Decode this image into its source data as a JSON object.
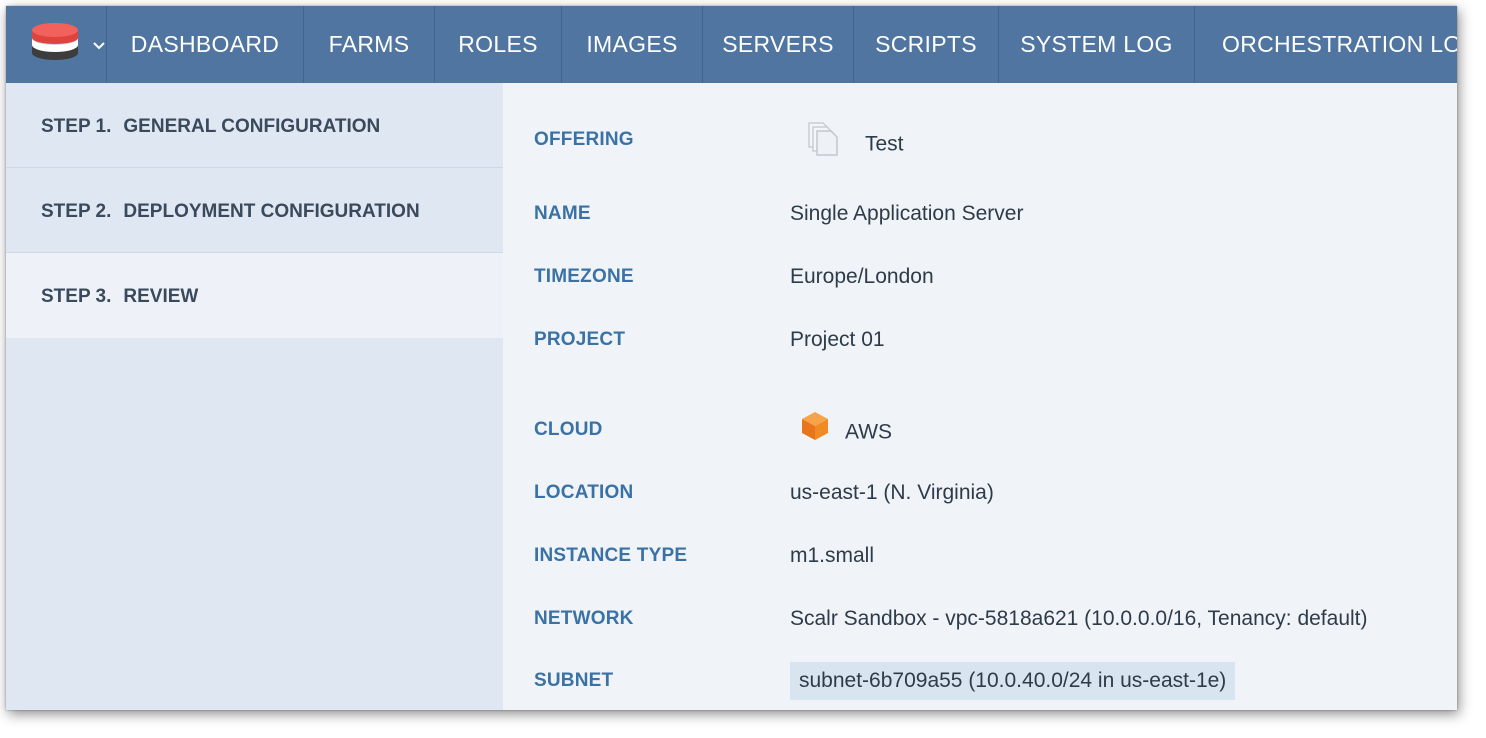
{
  "nav": {
    "logo_icon": "layered-stack-icon",
    "menu_icon": "chevron-down-icon",
    "items": [
      "DASHBOARD",
      "FARMS",
      "ROLES",
      "IMAGES",
      "SERVERS",
      "SCRIPTS",
      "SYSTEM LOG",
      "ORCHESTRATION LOG"
    ]
  },
  "steps": [
    {
      "num": "STEP 1.",
      "label": "GENERAL CONFIGURATION",
      "active": false
    },
    {
      "num": "STEP 2.",
      "label": "DEPLOYMENT CONFIGURATION",
      "active": false
    },
    {
      "num": "STEP 3.",
      "label": "REVIEW",
      "active": true
    }
  ],
  "review": {
    "offering": {
      "label": "OFFERING",
      "value": "Test",
      "icon": "copy-icon"
    },
    "name": {
      "label": "NAME",
      "value": "Single Application Server"
    },
    "timezone": {
      "label": "TIMEZONE",
      "value": "Europe/London"
    },
    "project": {
      "label": "PROJECT",
      "value": "Project 01"
    },
    "cloud": {
      "label": "CLOUD",
      "value": "AWS",
      "icon": "aws-cube-icon"
    },
    "location": {
      "label": "LOCATION",
      "value": "us-east-1 (N. Virginia)"
    },
    "instance_type": {
      "label": "INSTANCE TYPE",
      "value": "m1.small"
    },
    "network": {
      "label": "NETWORK",
      "value": "Scalr Sandbox - vpc-5818a621 (10.0.0.0/16, Tenancy: default)"
    },
    "subnet": {
      "label": "SUBNET",
      "value": "subnet-6b709a55 (10.0.40.0/24 in us-east-1e)"
    }
  },
  "colors": {
    "nav_bg": "#4f75a0",
    "label_blue": "#3b72a6",
    "aws_orange": "#f08a24",
    "logo_red": "#e0433d"
  }
}
